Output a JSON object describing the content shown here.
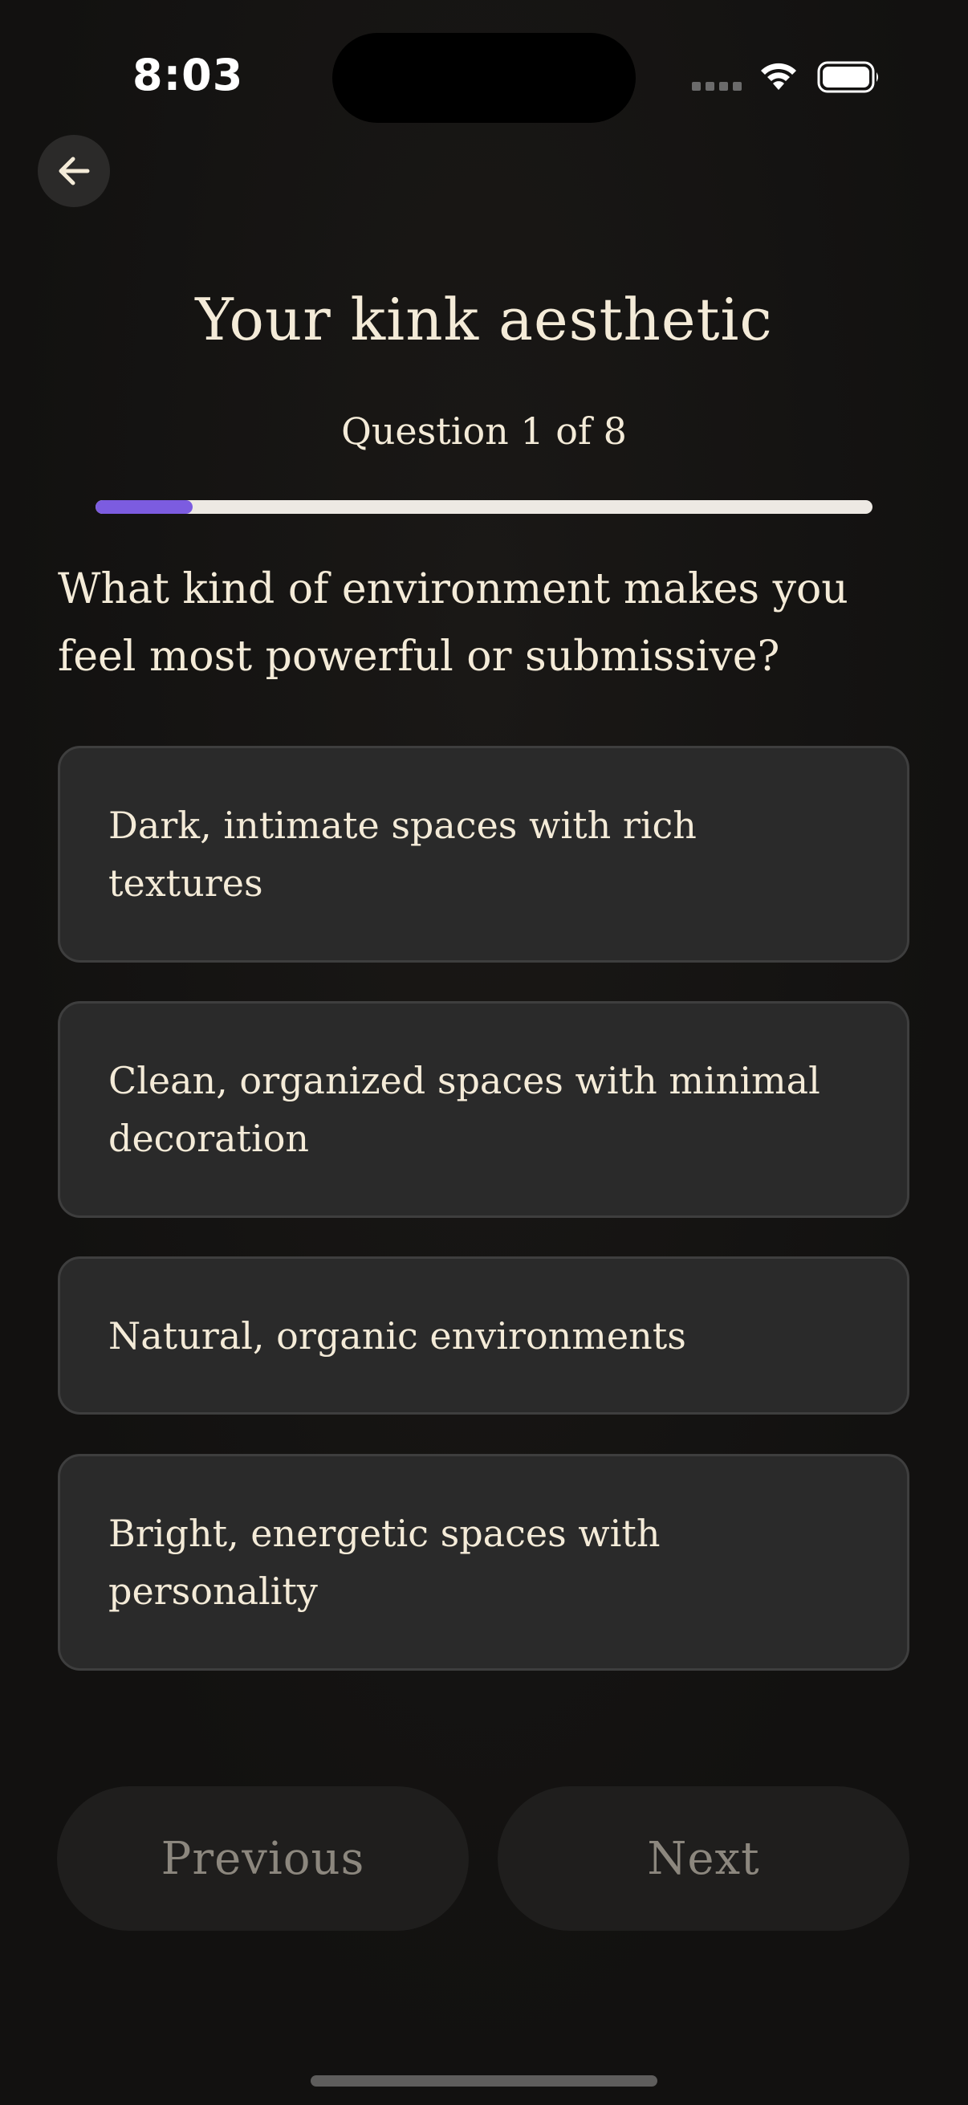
{
  "status_bar": {
    "time": "8:03"
  },
  "header": {
    "back_icon": "arrow-left-icon",
    "title": "Your kink aesthetic",
    "question_counter": "Question 1 of 8",
    "progress_fraction": 0.125
  },
  "question": {
    "text": "What kind of environment makes you feel most powerful or submissive?",
    "options": [
      {
        "label": "Dark, intimate spaces with rich textures"
      },
      {
        "label": "Clean, organized spaces with minimal decoration"
      },
      {
        "label": "Natural, organic environments"
      },
      {
        "label": "Bright, energetic spaces with personality"
      }
    ]
  },
  "footer": {
    "previous_label": "Previous",
    "next_label": "Next"
  },
  "colors": {
    "accent": "#7C5CE0",
    "text": "#F4EBD8",
    "background": "#131110",
    "card": "#2A2A2A"
  }
}
